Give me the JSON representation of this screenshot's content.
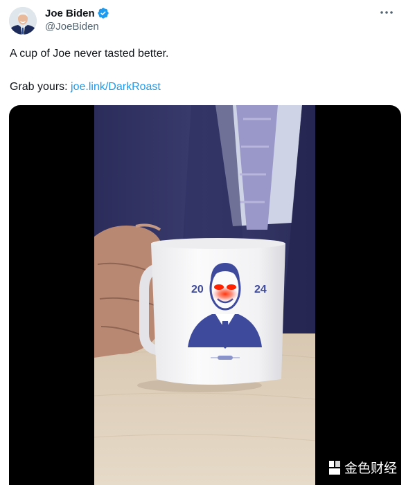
{
  "author": {
    "name": "Joe Biden",
    "handle": "@JoeBiden",
    "verified_color": "#1d9bf0"
  },
  "post": {
    "text_line1": "A cup of Joe never tasted better.",
    "text_prefix": "Grab yours: ",
    "link_text": "joe.link/DarkRoast",
    "link_color": "#1d9bf0"
  },
  "media": {
    "mug_left_number": "20",
    "mug_right_number": "24",
    "watermark_text": "金色财经"
  },
  "icons": {
    "more": "more-options-icon",
    "verified": "verified-badge-icon"
  }
}
